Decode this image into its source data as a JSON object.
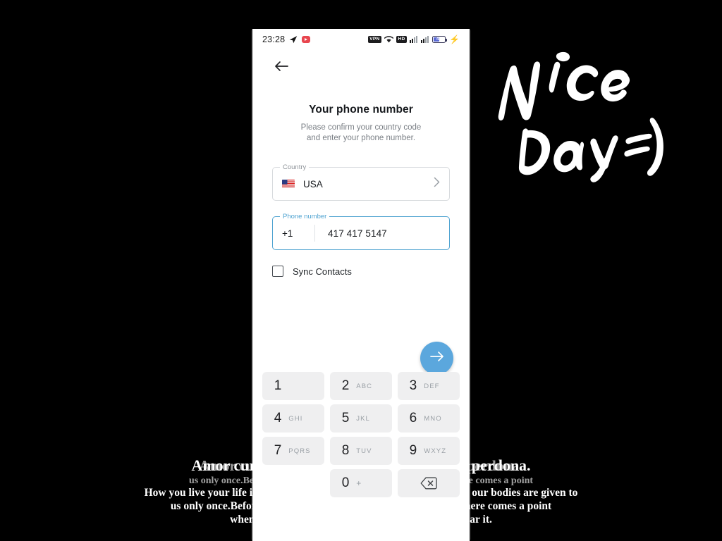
{
  "background": {
    "color": "#000000",
    "quote_title": "Amor cura, amor sana, amor amato amar perdona.",
    "quote_lines": [
      "How you live your life is your business. But remember, our hearts and our bodies are given to",
      "us only once.Before you know it,  beauty withers, as your body there comes a point",
      "when no one looks at it,  much less wants to come near it."
    ],
    "handwriting": {
      "line1": "Nice",
      "line2": "Day",
      "emoticon": "=)",
      "color": "#ffffff"
    }
  },
  "statusbar": {
    "time": "23:28",
    "left_icons": [
      "telegram-send-icon",
      "youtube-icon"
    ],
    "right_icons": [
      "vpn-badge",
      "wifi-icon",
      "hd-badge",
      "signal-sim1-icon",
      "signal-sim2-icon"
    ],
    "vpn_label": "VPN",
    "hd_label": "HD",
    "battery_percent": "41",
    "charging": true
  },
  "app": {
    "back_icon": "arrow-left-icon",
    "title": "Your phone number",
    "subtitle_line1": "Please confirm your country code",
    "subtitle_line2": "and enter your phone number.",
    "country_field": {
      "label": "Country",
      "value": "USA",
      "flag": "us-flag-icon",
      "chevron": "chevron-right-icon"
    },
    "phone_field": {
      "label": "Phone number",
      "country_code": "+1",
      "value": "417 417 5147",
      "focused": true,
      "accent_color": "#4fa3d1"
    },
    "sync_contacts": {
      "label": "Sync Contacts",
      "checked": false
    },
    "next_button": {
      "icon": "arrow-right-icon",
      "color": "#5ba7dd"
    }
  },
  "keypad": {
    "keys": [
      {
        "digit": "1",
        "letters": ""
      },
      {
        "digit": "2",
        "letters": "ABC"
      },
      {
        "digit": "3",
        "letters": "DEF"
      },
      {
        "digit": "4",
        "letters": "GHI"
      },
      {
        "digit": "5",
        "letters": "JKL"
      },
      {
        "digit": "6",
        "letters": "MNO"
      },
      {
        "digit": "7",
        "letters": "PQRS"
      },
      {
        "digit": "8",
        "letters": "TUV"
      },
      {
        "digit": "9",
        "letters": "WXYZ"
      },
      {
        "digit": "",
        "letters": ""
      },
      {
        "digit": "0",
        "letters": "+"
      },
      {
        "digit": "",
        "letters": "",
        "icon": "backspace-icon"
      }
    ]
  }
}
